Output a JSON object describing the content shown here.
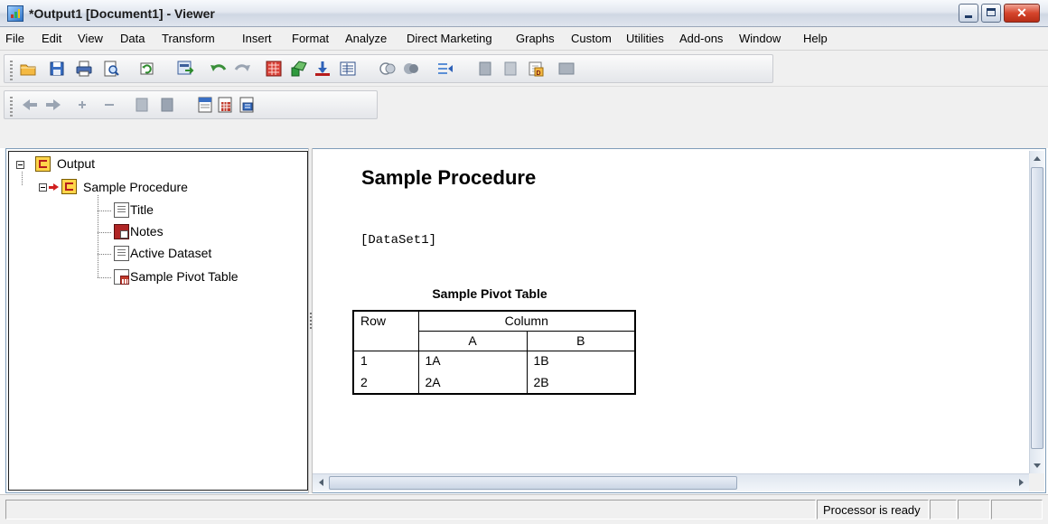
{
  "window": {
    "title": "*Output1 [Document1] - Viewer"
  },
  "menubar": {
    "items": [
      {
        "label": "File",
        "mnemonic": "F"
      },
      {
        "label": "Edit",
        "mnemonic": "E"
      },
      {
        "label": "View",
        "mnemonic": "V"
      },
      {
        "label": "Data",
        "mnemonic": "D"
      },
      {
        "label": "Transform",
        "mnemonic": "T"
      },
      {
        "label": "Insert",
        "mnemonic": "I"
      },
      {
        "label": "Format",
        "mnemonic": "o"
      },
      {
        "label": "Analyze",
        "mnemonic": "A"
      },
      {
        "label": "Direct Marketing",
        "mnemonic": "M"
      },
      {
        "label": "Graphs",
        "mnemonic": "G"
      },
      {
        "label": "Custom",
        "mnemonic": "C"
      },
      {
        "label": "Utilities",
        "mnemonic": "U"
      },
      {
        "label": "Add-ons",
        "mnemonic": "o"
      },
      {
        "label": "Window",
        "mnemonic": "W"
      },
      {
        "label": "Help",
        "mnemonic": "H"
      }
    ]
  },
  "toolbar_main": {
    "icons": [
      "open-folder-icon",
      "save-icon",
      "print-icon",
      "print-preview-icon",
      "recall-dialog-icon",
      "export-icon",
      "undo-icon",
      "redo-icon",
      "goto-data-icon",
      "goto-case-icon",
      "select-last-output-icon",
      "designate-window-icon",
      "show-all-icon",
      "hide-icon",
      "collapse-icon",
      "promote-icon",
      "demote-icon",
      "insert-heading-icon",
      "insert-title-icon",
      "insert-text-icon"
    ]
  },
  "toolbar_outline": {
    "icons": [
      "promote-arrow-icon",
      "demote-arrow-icon",
      "expand-plus-icon",
      "collapse-minus-icon",
      "show-icon",
      "hide-item-icon",
      "insert-heading-icon",
      "insert-title-icon",
      "insert-text-icon"
    ]
  },
  "outline": {
    "root": "Output",
    "procedure": "Sample Procedure",
    "children": [
      "Title",
      "Notes",
      "Active Dataset",
      "Sample Pivot Table"
    ]
  },
  "content": {
    "procedure_title": "Sample Procedure",
    "dataset_label": "[DataSet1]",
    "pivot": {
      "title": "Sample Pivot Table",
      "row_header": "Row",
      "column_header": "Column",
      "sub_headers": [
        "A",
        "B"
      ],
      "rows": [
        {
          "label": "1",
          "a": "1A",
          "b": "1B"
        },
        {
          "label": "2",
          "a": "2A",
          "b": "2B"
        }
      ]
    }
  },
  "statusbar": {
    "message": "Processor is ready"
  }
}
